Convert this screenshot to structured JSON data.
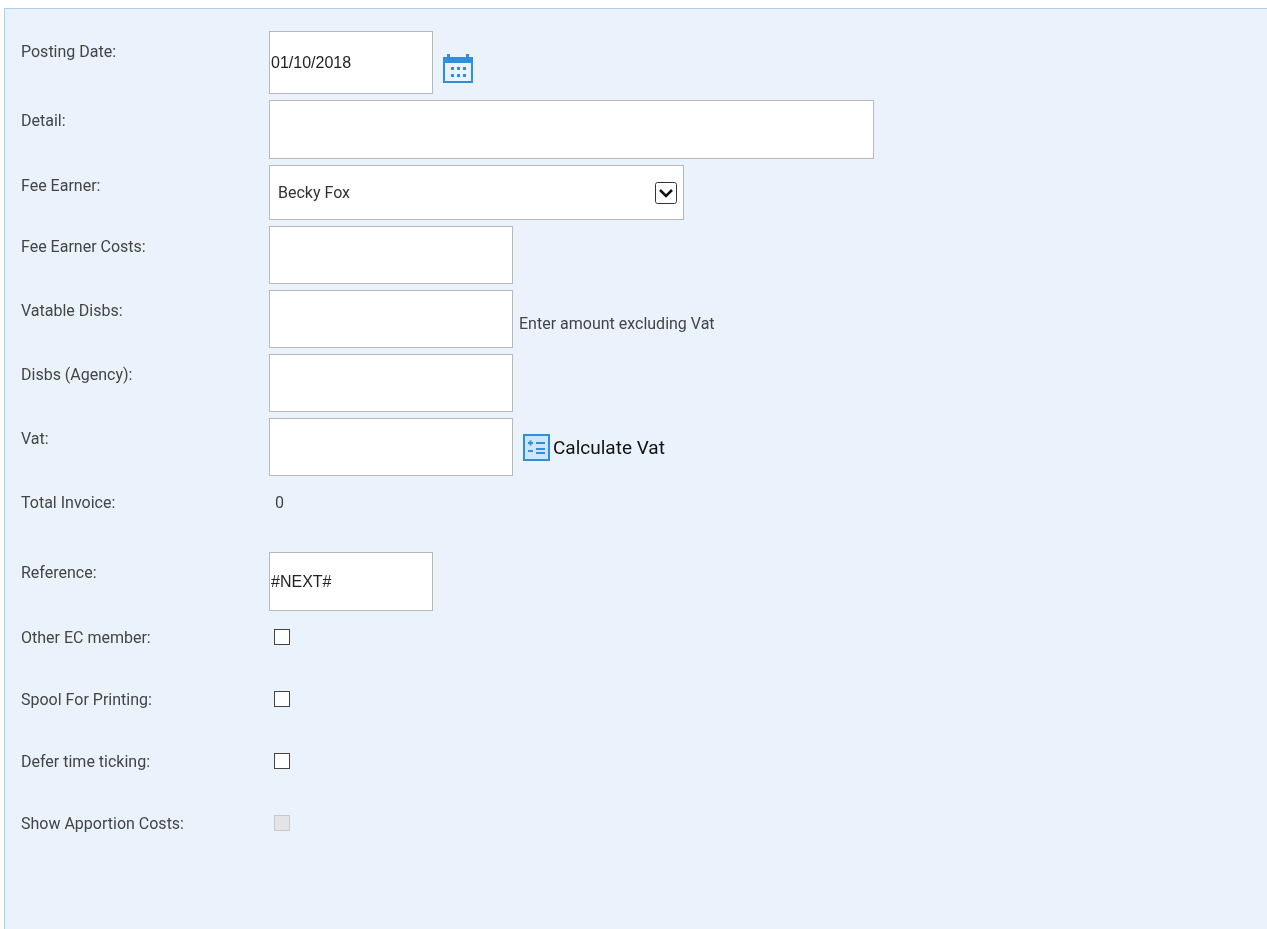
{
  "form": {
    "fields": [
      {
        "kind": "date",
        "label": "Posting Date:",
        "value": "01/10/2018"
      },
      {
        "kind": "long_text",
        "label": "Detail:"
      },
      {
        "kind": "select",
        "label": "Fee Earner:",
        "value": "Becky Fox"
      },
      {
        "kind": "text",
        "label": "Fee Earner Costs:"
      },
      {
        "kind": "text",
        "label": "Vatable Disbs:",
        "note": "Enter amount excluding Vat"
      },
      {
        "kind": "text",
        "label": "Disbs (Agency):"
      },
      {
        "kind": "text",
        "label": "Vat:",
        "action": "Calculate Vat"
      },
      {
        "kind": "static",
        "label": "Total Invoice:",
        "value": "0"
      },
      {
        "kind": "short_text",
        "label": "Reference:",
        "value": "#NEXT#"
      },
      {
        "kind": "checkbox",
        "label": "Other EC member:",
        "checked": false,
        "disabled": false
      },
      {
        "kind": "checkbox",
        "label": "Spool For Printing:",
        "checked": false,
        "disabled": false
      },
      {
        "kind": "checkbox",
        "label": "Defer time ticking:",
        "checked": false,
        "disabled": false
      },
      {
        "kind": "checkbox",
        "label": "Show Apportion Costs:",
        "checked": false,
        "disabled": true
      }
    ]
  }
}
